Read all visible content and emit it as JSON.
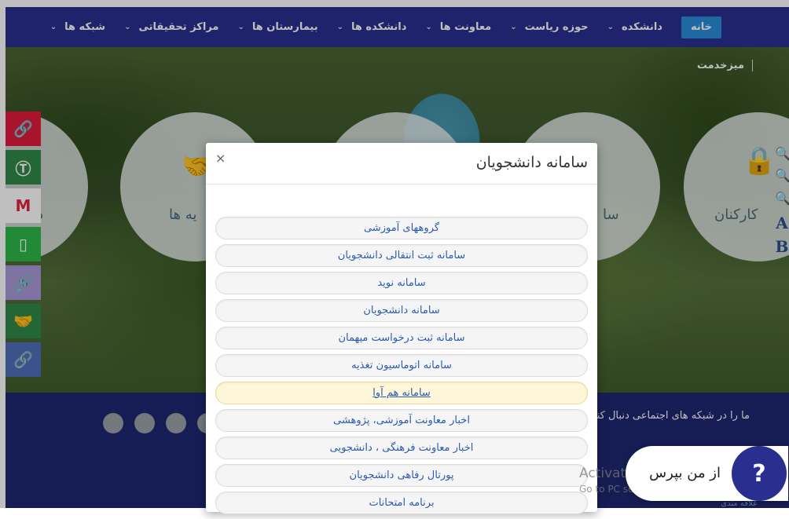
{
  "nav": {
    "home": "خانه",
    "items": [
      "دانشکده",
      "حوزه ریاست",
      "معاونت ها",
      "دانشکده ها",
      "بیمارستان ها",
      "مراکز تحقیقاتی",
      "شبکه ها"
    ]
  },
  "breadcrumb": "میزخدمت",
  "circles": {
    "right_label": "کارکنان",
    "mid_right_label": "سا",
    "left_label": "یه ها",
    "far_left_label": "د"
  },
  "accessibility": {
    "font_big": "A",
    "font_bold": "B"
  },
  "footer": {
    "social_text": "ما را در شبکه های اجتماعی دنبال کنید",
    "logo_text": "علاقه مندی"
  },
  "modal": {
    "title": "سامانه دانشجویان",
    "close": "×",
    "items": [
      "گروههای آموزشی",
      "سامانه ثبت انتقالی دانشجویان",
      "سامانه نوید",
      "سامانه دانشجویان",
      "سامانه ثبت درخواست میهمان",
      "سامانه اتوماسیون تغذیه",
      "سامانه هم آوا",
      "اخبار معاونت آموزشی، پژوهشی",
      "اخبار معاونت فرهنگی ، دانشجویی",
      "پورتال رفاهی دانشجویان",
      "برنامه امتحانات"
    ],
    "active_index": 6
  },
  "chat": {
    "label": "از من بپرس",
    "button": "?"
  },
  "watermark": {
    "line1": "Activate Windows",
    "line2": "Go to PC settings to activate Windows."
  },
  "colors": {
    "nav": "#2a2f8f",
    "home_button": "#2a8cd9",
    "footer": "#1e2772",
    "link": "#2a5bb0"
  }
}
